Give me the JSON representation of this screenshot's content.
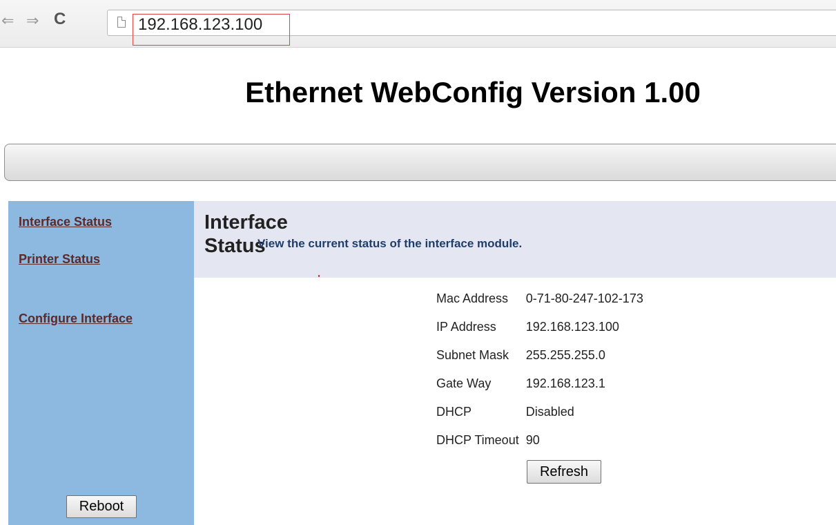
{
  "browser": {
    "back_glyph": "⇐",
    "forward_glyph": "⇒",
    "reload_glyph": "C",
    "url": "192.168.123.100"
  },
  "page": {
    "title": "Ethernet WebConfig Version 1.00"
  },
  "sidebar": {
    "links": [
      {
        "label": "Interface Status"
      },
      {
        "label": "Printer Status"
      },
      {
        "label": "Configure Interface"
      }
    ],
    "reboot_label": "Reboot"
  },
  "content": {
    "section_title": "Interface Status",
    "description": "View the current status of the interface module.",
    "rows": [
      {
        "label": "Mac Address",
        "value": "0-71-80-247-102-173"
      },
      {
        "label": "IP Address",
        "value": "192.168.123.100"
      },
      {
        "label": "Subnet Mask",
        "value": "255.255.255.0"
      },
      {
        "label": "Gate Way",
        "value": "192.168.123.1"
      },
      {
        "label": "DHCP",
        "value": "Disabled"
      },
      {
        "label": "DHCP Timeout",
        "value": "90"
      }
    ],
    "refresh_label": "Refresh"
  },
  "colors": {
    "sidebar_bg": "#8db8e0",
    "header_bg": "#e4e7f1",
    "link_color": "#5b2a2a",
    "description_color": "#1f3d6b",
    "url_highlight": "#e0443e"
  }
}
